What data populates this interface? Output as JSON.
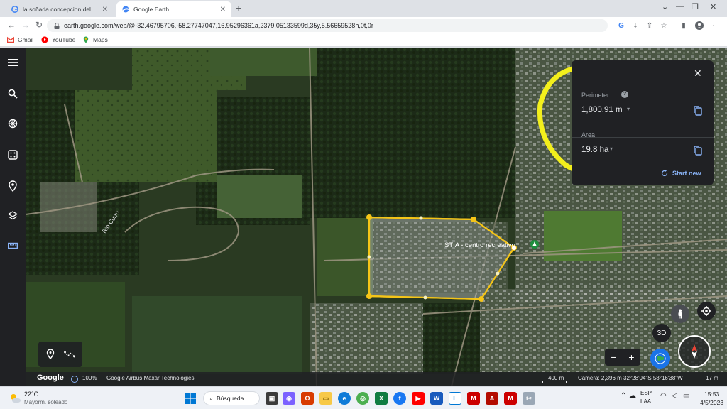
{
  "browser": {
    "tabs": [
      {
        "title": "la soñada concepcion del urugu",
        "active": false
      },
      {
        "title": "Google Earth",
        "active": true
      }
    ],
    "url": "earth.google.com/web/@-32.46795706,-58.27747047,16.95296361a,2379.05133599d,35y,5.56659528h,0t,0r",
    "bookmarks": [
      "Gmail",
      "YouTube",
      "Maps"
    ]
  },
  "map": {
    "labels": {
      "place": "STIA - centro recreativo",
      "river": "Rio Curro"
    },
    "polygon_color": "#f5c518",
    "annotation_color": "#f3ef1c"
  },
  "measure": {
    "perimeter_label": "Perimeter",
    "perimeter_value": "1,800.91 m",
    "area_label": "Area",
    "area_value": "19.8 ha",
    "start_new": "Start new"
  },
  "earth_controls": {
    "view_3d": "3D"
  },
  "statusbar": {
    "logo": "Google",
    "zoom": "100%",
    "attribution": "Google  Airbus  Maxar Technologies",
    "scale": "400 m",
    "camera": "Camera: 2,396 m   32°28'04\"S 58°16'38\"W",
    "altitude": "17 m"
  },
  "taskbar": {
    "temperature": "22°C",
    "weather": "Mayorm. soleado",
    "search": "Búsqueda",
    "lang_top": "ESP",
    "lang_bottom": "LAA",
    "time": "15:53",
    "date": "4/5/2023"
  }
}
